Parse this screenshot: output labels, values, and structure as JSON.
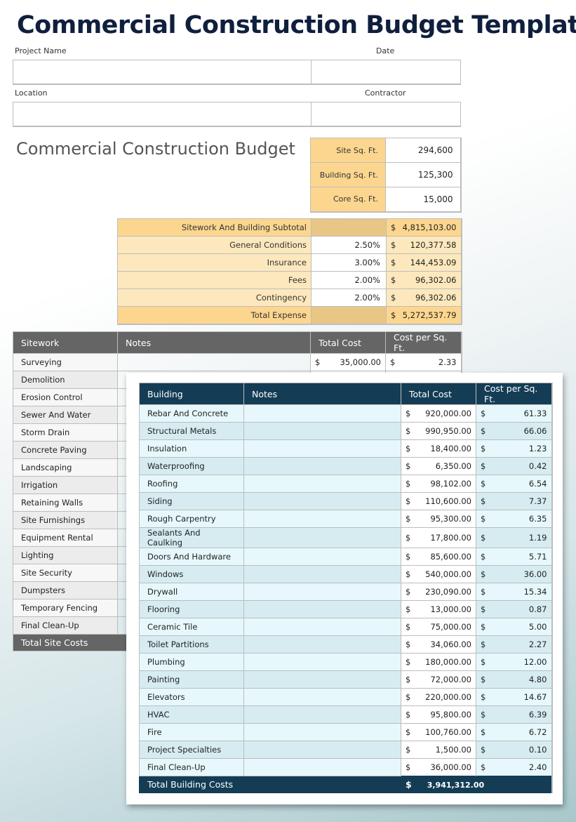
{
  "title": "Commercial Construction Budget Template",
  "header_fields": {
    "project_name_label": "Project Name",
    "project_name_value": "",
    "date_label": "Date",
    "date_value": "",
    "location_label": "Location",
    "location_value": "",
    "contractor_label": "Contractor",
    "contractor_value": ""
  },
  "subtitle": "Commercial Construction Budget",
  "sqft": [
    {
      "label": "Site  Sq. Ft.",
      "value": "294,600"
    },
    {
      "label": "Building Sq. Ft.",
      "value": "125,300"
    },
    {
      "label": "Core Sq. Ft.",
      "value": "15,000"
    }
  ],
  "summary": [
    {
      "label": "Sitework And Building Subtotal",
      "pct": "",
      "currency": "$",
      "amount": "4,815,103.00",
      "highlight": true
    },
    {
      "label": "General Conditions",
      "pct": "2.50%",
      "currency": "$",
      "amount": "120,377.58",
      "highlight": false
    },
    {
      "label": "Insurance",
      "pct": "3.00%",
      "currency": "$",
      "amount": "144,453.09",
      "highlight": false
    },
    {
      "label": "Fees",
      "pct": "2.00%",
      "currency": "$",
      "amount": "96,302.06",
      "highlight": false
    },
    {
      "label": "Contingency",
      "pct": "2.00%",
      "currency": "$",
      "amount": "96,302.06",
      "highlight": false
    },
    {
      "label": "Total Expense",
      "pct": "",
      "currency": "$",
      "amount": "5,272,537.79",
      "highlight": true
    }
  ],
  "sitework": {
    "headers": [
      "Sitework",
      "Notes",
      "Total Cost",
      "Cost per Sq. Ft."
    ],
    "rows": [
      {
        "name": "Surveying",
        "notes": "",
        "total_currency": "$",
        "total": "35,000.00",
        "per_currency": "$",
        "per_sqft": "2.33"
      },
      {
        "name": "Demolition",
        "notes": "",
        "total_currency": "",
        "total": "",
        "per_currency": "",
        "per_sqft": ""
      },
      {
        "name": "Erosion Control",
        "notes": "",
        "total_currency": "",
        "total": "",
        "per_currency": "",
        "per_sqft": ""
      },
      {
        "name": "Sewer And Water",
        "notes": "",
        "total_currency": "",
        "total": "",
        "per_currency": "",
        "per_sqft": ""
      },
      {
        "name": "Storm Drain",
        "notes": "",
        "total_currency": "",
        "total": "",
        "per_currency": "",
        "per_sqft": ""
      },
      {
        "name": "Concrete Paving",
        "notes": "",
        "total_currency": "",
        "total": "",
        "per_currency": "",
        "per_sqft": ""
      },
      {
        "name": "Landscaping",
        "notes": "",
        "total_currency": "",
        "total": "",
        "per_currency": "",
        "per_sqft": ""
      },
      {
        "name": "Irrigation",
        "notes": "",
        "total_currency": "",
        "total": "",
        "per_currency": "",
        "per_sqft": ""
      },
      {
        "name": "Retaining Walls",
        "notes": "",
        "total_currency": "",
        "total": "",
        "per_currency": "",
        "per_sqft": ""
      },
      {
        "name": "Site Furnishings",
        "notes": "",
        "total_currency": "",
        "total": "",
        "per_currency": "",
        "per_sqft": ""
      },
      {
        "name": "Equipment Rental",
        "notes": "",
        "total_currency": "",
        "total": "",
        "per_currency": "",
        "per_sqft": ""
      },
      {
        "name": "Lighting",
        "notes": "",
        "total_currency": "",
        "total": "",
        "per_currency": "",
        "per_sqft": ""
      },
      {
        "name": "Site Security",
        "notes": "",
        "total_currency": "",
        "total": "",
        "per_currency": "",
        "per_sqft": ""
      },
      {
        "name": "Dumpsters",
        "notes": "",
        "total_currency": "",
        "total": "",
        "per_currency": "",
        "per_sqft": ""
      },
      {
        "name": "Temporary Fencing",
        "notes": "",
        "total_currency": "",
        "total": "",
        "per_currency": "",
        "per_sqft": ""
      },
      {
        "name": "Final Clean-Up",
        "notes": "",
        "total_currency": "",
        "total": "",
        "per_currency": "",
        "per_sqft": ""
      }
    ],
    "total_label": "Total Site Costs"
  },
  "building": {
    "headers": [
      "Building",
      "Notes",
      "Total Cost",
      "Cost per Sq. Ft."
    ],
    "rows": [
      {
        "name": "Rebar And Concrete",
        "notes": "",
        "total_currency": "$",
        "total": "920,000.00",
        "per_currency": "$",
        "per_sqft": "61.33"
      },
      {
        "name": "Structural Metals",
        "notes": "",
        "total_currency": "$",
        "total": "990,950.00",
        "per_currency": "$",
        "per_sqft": "66.06"
      },
      {
        "name": "Insulation",
        "notes": "",
        "total_currency": "$",
        "total": "18,400.00",
        "per_currency": "$",
        "per_sqft": "1.23"
      },
      {
        "name": "Waterproofing",
        "notes": "",
        "total_currency": "$",
        "total": "6,350.00",
        "per_currency": "$",
        "per_sqft": "0.42"
      },
      {
        "name": "Roofing",
        "notes": "",
        "total_currency": "$",
        "total": "98,102.00",
        "per_currency": "$",
        "per_sqft": "6.54"
      },
      {
        "name": "Siding",
        "notes": "",
        "total_currency": "$",
        "total": "110,600.00",
        "per_currency": "$",
        "per_sqft": "7.37"
      },
      {
        "name": "Rough Carpentry",
        "notes": "",
        "total_currency": "$",
        "total": "95,300.00",
        "per_currency": "$",
        "per_sqft": "6.35"
      },
      {
        "name": "Sealants And Caulking",
        "notes": "",
        "total_currency": "$",
        "total": "17,800.00",
        "per_currency": "$",
        "per_sqft": "1.19"
      },
      {
        "name": "Doors And Hardware",
        "notes": "",
        "total_currency": "$",
        "total": "85,600.00",
        "per_currency": "$",
        "per_sqft": "5.71"
      },
      {
        "name": "Windows",
        "notes": "",
        "total_currency": "$",
        "total": "540,000.00",
        "per_currency": "$",
        "per_sqft": "36.00"
      },
      {
        "name": "Drywall",
        "notes": "",
        "total_currency": "$",
        "total": "230,090.00",
        "per_currency": "$",
        "per_sqft": "15.34"
      },
      {
        "name": "Flooring",
        "notes": "",
        "total_currency": "$",
        "total": "13,000.00",
        "per_currency": "$",
        "per_sqft": "0.87"
      },
      {
        "name": "Ceramic Tile",
        "notes": "",
        "total_currency": "$",
        "total": "75,000.00",
        "per_currency": "$",
        "per_sqft": "5.00"
      },
      {
        "name": "Toilet Partitions",
        "notes": "",
        "total_currency": "$",
        "total": "34,060.00",
        "per_currency": "$",
        "per_sqft": "2.27"
      },
      {
        "name": "Plumbing",
        "notes": "",
        "total_currency": "$",
        "total": "180,000.00",
        "per_currency": "$",
        "per_sqft": "12.00"
      },
      {
        "name": "Painting",
        "notes": "",
        "total_currency": "$",
        "total": "72,000.00",
        "per_currency": "$",
        "per_sqft": "4.80"
      },
      {
        "name": "Elevators",
        "notes": "",
        "total_currency": "$",
        "total": "220,000.00",
        "per_currency": "$",
        "per_sqft": "14.67"
      },
      {
        "name": "HVAC",
        "notes": "",
        "total_currency": "$",
        "total": "95,800.00",
        "per_currency": "$",
        "per_sqft": "6.39"
      },
      {
        "name": "Fire",
        "notes": "",
        "total_currency": "$",
        "total": "100,760.00",
        "per_currency": "$",
        "per_sqft": "6.72"
      },
      {
        "name": "Project Specialties",
        "notes": "",
        "total_currency": "$",
        "total": "1,500.00",
        "per_currency": "$",
        "per_sqft": "0.10"
      },
      {
        "name": "Final Clean-Up",
        "notes": "",
        "total_currency": "$",
        "total": "36,000.00",
        "per_currency": "$",
        "per_sqft": "2.40"
      }
    ],
    "total_label": "Total Building Costs",
    "total_currency": "$",
    "total_value": "3,941,312.00"
  }
}
